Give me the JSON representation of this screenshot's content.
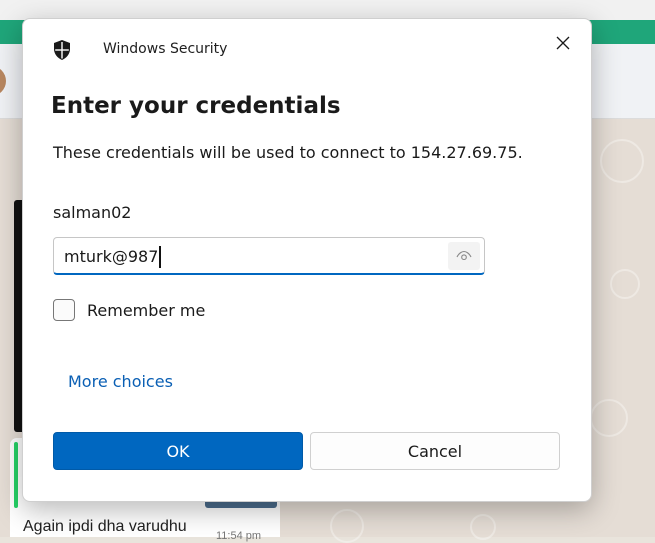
{
  "dialog": {
    "app_title": "Windows Security",
    "heading": "Enter your credentials",
    "description": "These credentials will be used to connect to 154.27.69.75.",
    "username": "salman02",
    "password_value": "mturk@987",
    "remember_label": "Remember me",
    "remember_checked": false,
    "more_choices": "More choices",
    "ok_label": "OK",
    "cancel_label": "Cancel",
    "icons": {
      "app": "shield-icon",
      "close": "close-icon",
      "reveal": "eye-icon"
    },
    "colors": {
      "accent": "#0067c0",
      "link": "#0a5fb4"
    }
  },
  "background": {
    "message_text": "Again ipdi dha varudhu",
    "message_time": "11:54 pm",
    "colors": {
      "header_accent": "#1fa67a",
      "chat_bg": "#e5ddd5"
    }
  }
}
